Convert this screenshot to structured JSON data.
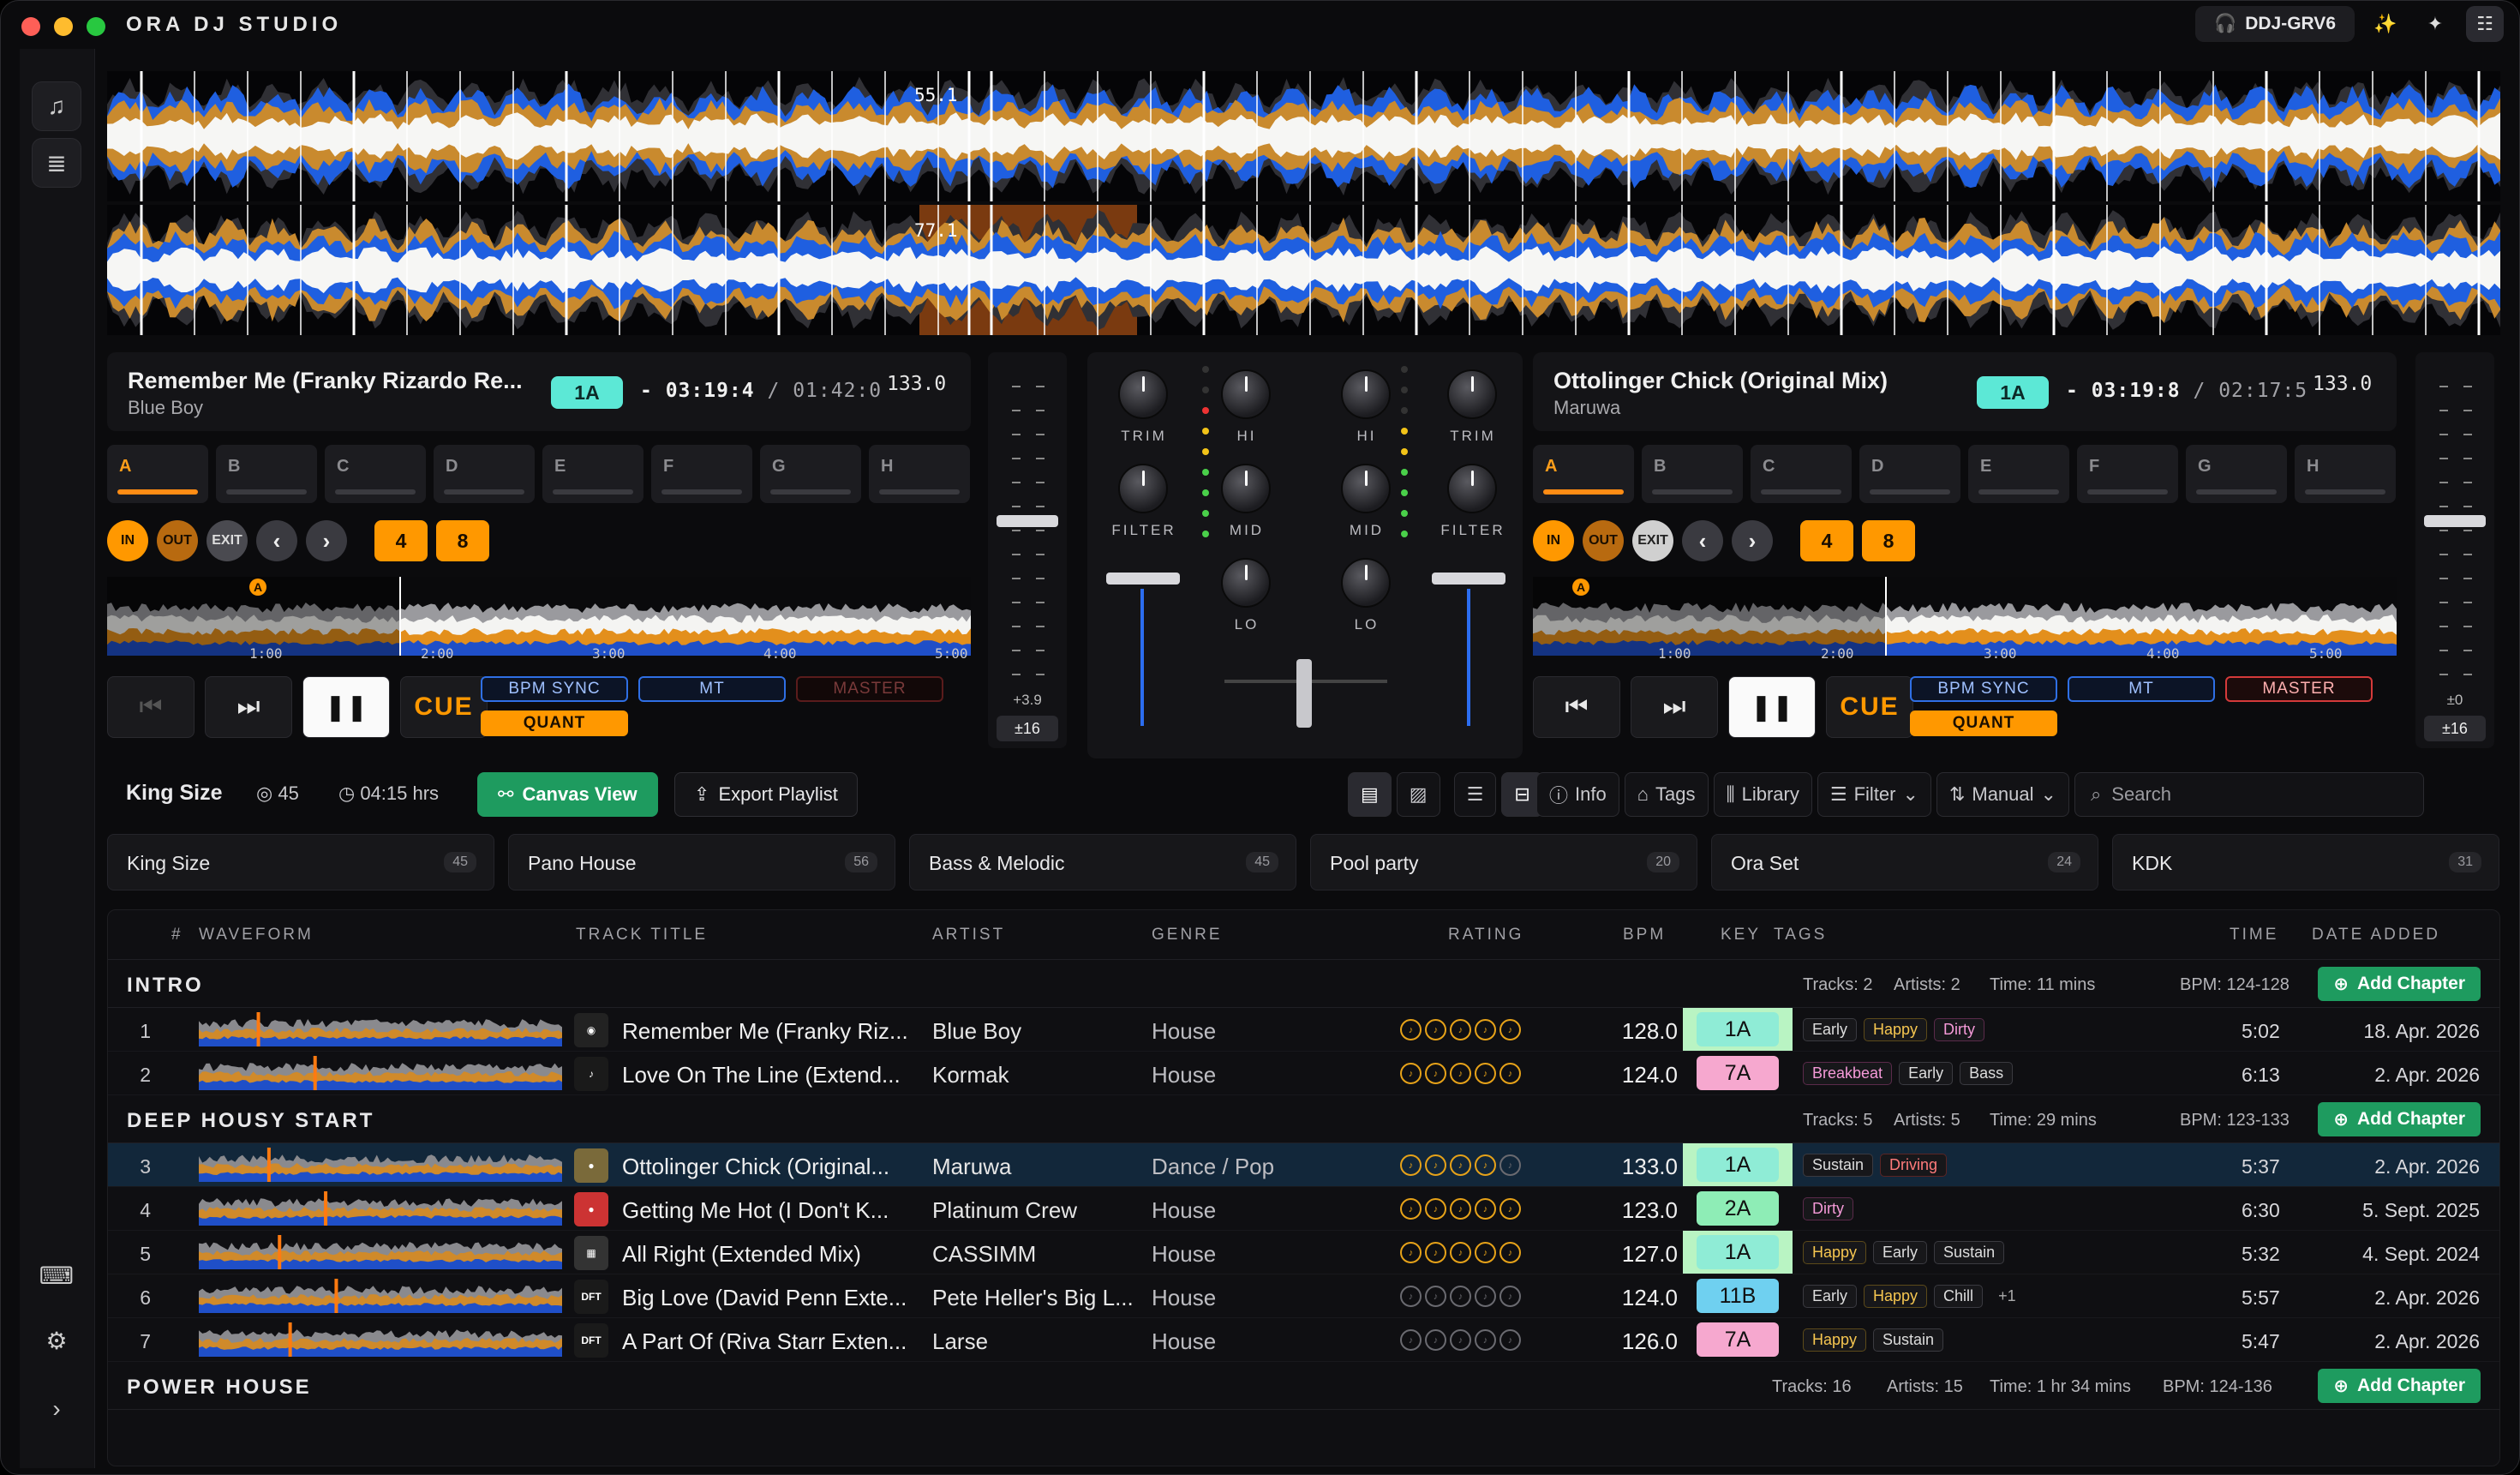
{
  "app": {
    "title": "ORA DJ STUDIO",
    "device": "DDJ-GRV6"
  },
  "top_waves": {
    "marker_top": "55.1",
    "marker_bottom": "77.1"
  },
  "deck_a": {
    "title": "Remember Me (Franky Rizardo Re...",
    "artist": "Blue Boy",
    "key": "1A",
    "elapsed": "- 03:19:4",
    "total": "01:42:0",
    "bpm": "133.0",
    "pads": [
      "A",
      "B",
      "C",
      "D",
      "E",
      "F",
      "G",
      "H"
    ],
    "loop": {
      "in": "IN",
      "out": "OUT",
      "exit": "EXIT",
      "prev": "‹",
      "next": "›",
      "len1": "4",
      "len2": "8"
    },
    "ticks": [
      "1:00",
      "2:00",
      "3:00",
      "4:00",
      "5:00"
    ],
    "cue_marker": "A",
    "cue": "CUE",
    "sync": "BPM SYNC",
    "mt": "MT",
    "master": "MASTER",
    "quant": "QUANT",
    "pitch_value": "+3.9",
    "pitch_range": "±16"
  },
  "deck_b": {
    "title": "Ottolinger Chick (Original Mix)",
    "artist": "Maruwa",
    "key": "1A",
    "elapsed": "- 03:19:8",
    "total": "02:17:5",
    "bpm": "133.0",
    "pads": [
      "A",
      "B",
      "C",
      "D",
      "E",
      "F",
      "G",
      "H"
    ],
    "loop": {
      "in": "IN",
      "out": "OUT",
      "exit": "EXIT",
      "prev": "‹",
      "next": "›",
      "len1": "4",
      "len2": "8"
    },
    "ticks": [
      "1:00",
      "2:00",
      "3:00",
      "4:00",
      "5:00"
    ],
    "cue_marker": "A",
    "cue": "CUE",
    "sync": "BPM SYNC",
    "mt": "MT",
    "master": "MASTER",
    "quant": "QUANT",
    "pitch_value": "±0",
    "pitch_range": "±16"
  },
  "mixer": {
    "trim": "TRIM",
    "hi": "HI",
    "filter": "FILTER",
    "mid": "MID",
    "lo": "LO"
  },
  "toolbar": {
    "playlist": "King Size",
    "count": "45",
    "duration": "04:15 hrs",
    "canvas_view": "Canvas View",
    "export": "Export Playlist",
    "info": "Info",
    "tags": "Tags",
    "library": "Library",
    "filter": "Filter",
    "manual": "Manual",
    "search_placeholder": "Search"
  },
  "playlists": [
    {
      "name": "King Size",
      "count": "45"
    },
    {
      "name": "Pano House",
      "count": "56"
    },
    {
      "name": "Bass & Melodic",
      "count": "45"
    },
    {
      "name": "Pool party",
      "count": "20"
    },
    {
      "name": "Ora Set",
      "count": "24"
    },
    {
      "name": "KDK",
      "count": "31"
    }
  ],
  "columns": {
    "num": "#",
    "waveform": "WAVEFORM",
    "title": "TRACK TITLE",
    "artist": "ARTIST",
    "genre": "GENRE",
    "rating": "RATING",
    "bpm": "BPM",
    "key": "KEY",
    "tags": "TAGS",
    "time": "TIME",
    "added": "DATE ADDED"
  },
  "add_chapter": "Add Chapter",
  "chapters": [
    {
      "name": "INTRO",
      "tracks": "Tracks: 2",
      "artists": "Artists: 2",
      "time": "Time: 11 mins",
      "bpm": "BPM: 124-128"
    },
    {
      "name": "DEEP HOUSY START",
      "tracks": "Tracks: 5",
      "artists": "Artists: 5",
      "time": "Time: 29 mins",
      "bpm": "BPM: 123-133"
    },
    {
      "name": "POWER HOUSE",
      "tracks": "Tracks: 16",
      "artists": "Artists: 15",
      "time": "Time: 1 hr 34 mins",
      "bpm": "BPM: 124-136"
    }
  ],
  "tracks": [
    {
      "n": "1",
      "title": "Remember Me (Franky Riz...",
      "artist": "Blue Boy",
      "genre": "House",
      "rating": 5,
      "bpm": "128.0",
      "key": "1A",
      "key_color": "#8fecd6",
      "tags": [
        "Early",
        "Happy",
        "Dirty"
      ],
      "time": "5:02",
      "added": "18. Apr. 2026"
    },
    {
      "n": "2",
      "title": "Love On The Line (Extend...",
      "artist": "Kormak",
      "genre": "House",
      "rating": 5,
      "bpm": "124.0",
      "key": "7A",
      "key_color": "#f6a8cf",
      "tags": [
        "Breakbeat",
        "Early",
        "Bass"
      ],
      "time": "6:13",
      "added": "2. Apr. 2026"
    },
    {
      "n": "3",
      "title": "Ottolinger Chick (Original...",
      "artist": "Maruwa",
      "genre": "Dance / Pop",
      "rating": 4,
      "bpm": "133.0",
      "key": "1A",
      "key_color": "#8fecd6",
      "tags": [
        "Sustain",
        "Driving"
      ],
      "time": "5:37",
      "added": "2. Apr. 2026"
    },
    {
      "n": "4",
      "title": "Getting Me Hot (I Don't K...",
      "artist": "Platinum Crew",
      "genre": "House",
      "rating": 5,
      "bpm": "123.0",
      "key": "2A",
      "key_color": "#8eedb6",
      "tags": [
        "Dirty"
      ],
      "time": "6:30",
      "added": "5. Sept. 2025"
    },
    {
      "n": "5",
      "title": "All Right (Extended Mix)",
      "artist": "CASSIMM",
      "genre": "House",
      "rating": 5,
      "bpm": "127.0",
      "key": "1A",
      "key_color": "#8fecd6",
      "tags": [
        "Happy",
        "Early",
        "Sustain"
      ],
      "time": "5:32",
      "added": "4. Sept. 2024"
    },
    {
      "n": "6",
      "title": "Big Love (David Penn Exte...",
      "artist": "Pete Heller's Big L...",
      "genre": "House",
      "rating": 0,
      "bpm": "124.0",
      "key": "11B",
      "key_color": "#6fd0f0",
      "tags": [
        "Early",
        "Happy",
        "Chill",
        "+1"
      ],
      "time": "5:57",
      "added": "2. Apr. 2026"
    },
    {
      "n": "7",
      "title": "A Part Of (Riva Starr Exten...",
      "artist": "Larse",
      "genre": "House",
      "rating": 0,
      "bpm": "126.0",
      "key": "7A",
      "key_color": "#f6a8cf",
      "tags": [
        "Happy",
        "Sustain"
      ],
      "time": "5:47",
      "added": "2. Apr. 2026"
    }
  ]
}
